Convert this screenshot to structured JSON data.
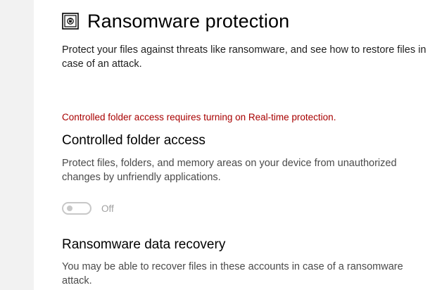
{
  "header": {
    "title": "Ransomware protection",
    "icon": "ransomware-protection-icon"
  },
  "intro": {
    "text": "Protect your files against threats like ransomware, and see how to restore files in case of an attack."
  },
  "warning": {
    "text": "Controlled folder access requires turning on Real-time protection."
  },
  "controlled_folder_access": {
    "title": "Controlled folder access",
    "description": "Protect files, folders, and memory areas on your device from unauthorized changes by unfriendly applications.",
    "toggle_state": "Off"
  },
  "ransomware_data_recovery": {
    "title": "Ransomware data recovery",
    "description": "You may be able to recover files in these accounts in case of a ransomware attack."
  },
  "colors": {
    "warning": "#a80000",
    "toggle_disabled": "#c8c8c8"
  }
}
